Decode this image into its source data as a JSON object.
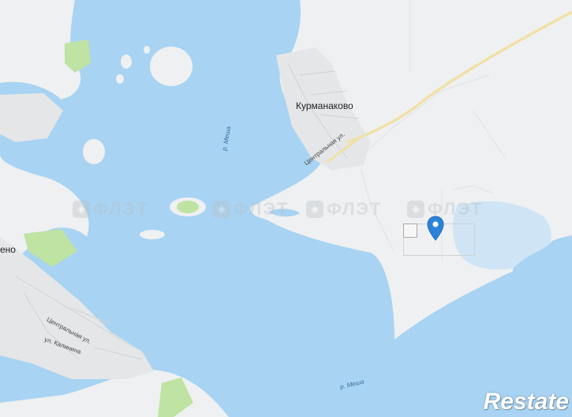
{
  "map": {
    "water_color": "#a8d3f2",
    "land_color": "#eef0f1",
    "forest_color": "#bfe3a3",
    "road_color": "#f1e1a6",
    "settlement_color": "#e4e6e8",
    "labels": {
      "village_kurmanakovo": "Курманаково",
      "village_left": "ено",
      "street_central_top": "Центральная ул.",
      "street_central_left": "Центральная ул.",
      "street_kalinina": "ул. Калинина",
      "river_top": "р. Меша",
      "river_bottom": "р. Меша"
    },
    "watermark_text": "ФЛЭТ",
    "brand": "Restate",
    "marker": {
      "icon": "map-pin-icon",
      "color": "#2b82d9"
    }
  }
}
